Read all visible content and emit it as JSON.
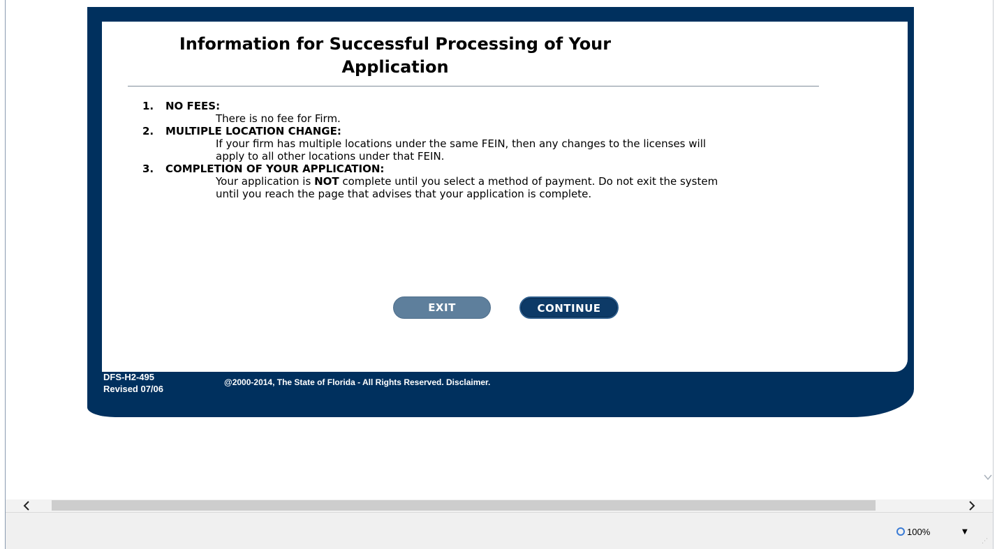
{
  "page": {
    "title": "Information for Successful Processing of Your Application",
    "items": [
      {
        "number": "1.",
        "heading": "NO FEES:",
        "text": "There is no fee for Firm."
      },
      {
        "number": "2.",
        "heading": "MULTIPLE LOCATION CHANGE:",
        "text": "If your firm has multiple locations under the same FEIN, then any changes to the licenses will apply to all other locations under that FEIN."
      },
      {
        "number": "3.",
        "heading": "COMPLETION OF YOUR APPLICATION:",
        "text_before": "Your application is ",
        "text_bold": "NOT",
        "text_after": " complete until you select a method of payment. Do not exit the system until you reach the page that advises that your application is complete."
      }
    ],
    "buttons": {
      "exit": "EXIT",
      "continue": "CONTINUE"
    },
    "footer": {
      "form_id": "DFS-H2-495",
      "revised": "Revised 07/06",
      "copyright": "@2000-2014, The State of Florida - All Rights Reserved. Disclaimer."
    }
  },
  "browser": {
    "zoom": "100%",
    "scroll_left_icon": "chevron-left-icon",
    "scroll_right_icon": "chevron-right-icon",
    "scroll_down_icon": "chevron-down-icon"
  },
  "colors": {
    "frame": "#00305e",
    "exit_button": "#5e7f9c",
    "continue_button": "#0d3a67"
  }
}
